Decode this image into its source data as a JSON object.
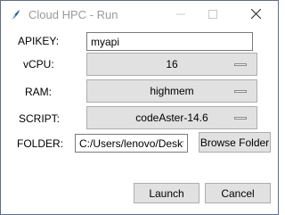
{
  "window": {
    "title": "Cloud HPC - Run",
    "icon": "feather-icon",
    "controls": [
      "minimize-icon",
      "maximize-icon",
      "close-icon"
    ]
  },
  "form": {
    "apikey_label": "APIKEY:",
    "apikey_value": "myapi",
    "vcpu_label": "vCPU:",
    "vcpu_value": "16",
    "ram_label": "RAM:",
    "ram_value": "highmem",
    "script_label": "SCRIPT:",
    "script_value": "codeAster-14.6",
    "folder_label": "FOLDER:",
    "folder_value": "C:/Users/lenovo/Deskt",
    "browse_label": "Browse Folder"
  },
  "actions": {
    "launch_label": "Launch",
    "cancel_label": "Cancel"
  },
  "colors": {
    "button_bg": "#e1e1e1",
    "button_border": "#adadad",
    "title_text": "#9a9a9a",
    "window_border": "#5b6f8a"
  }
}
